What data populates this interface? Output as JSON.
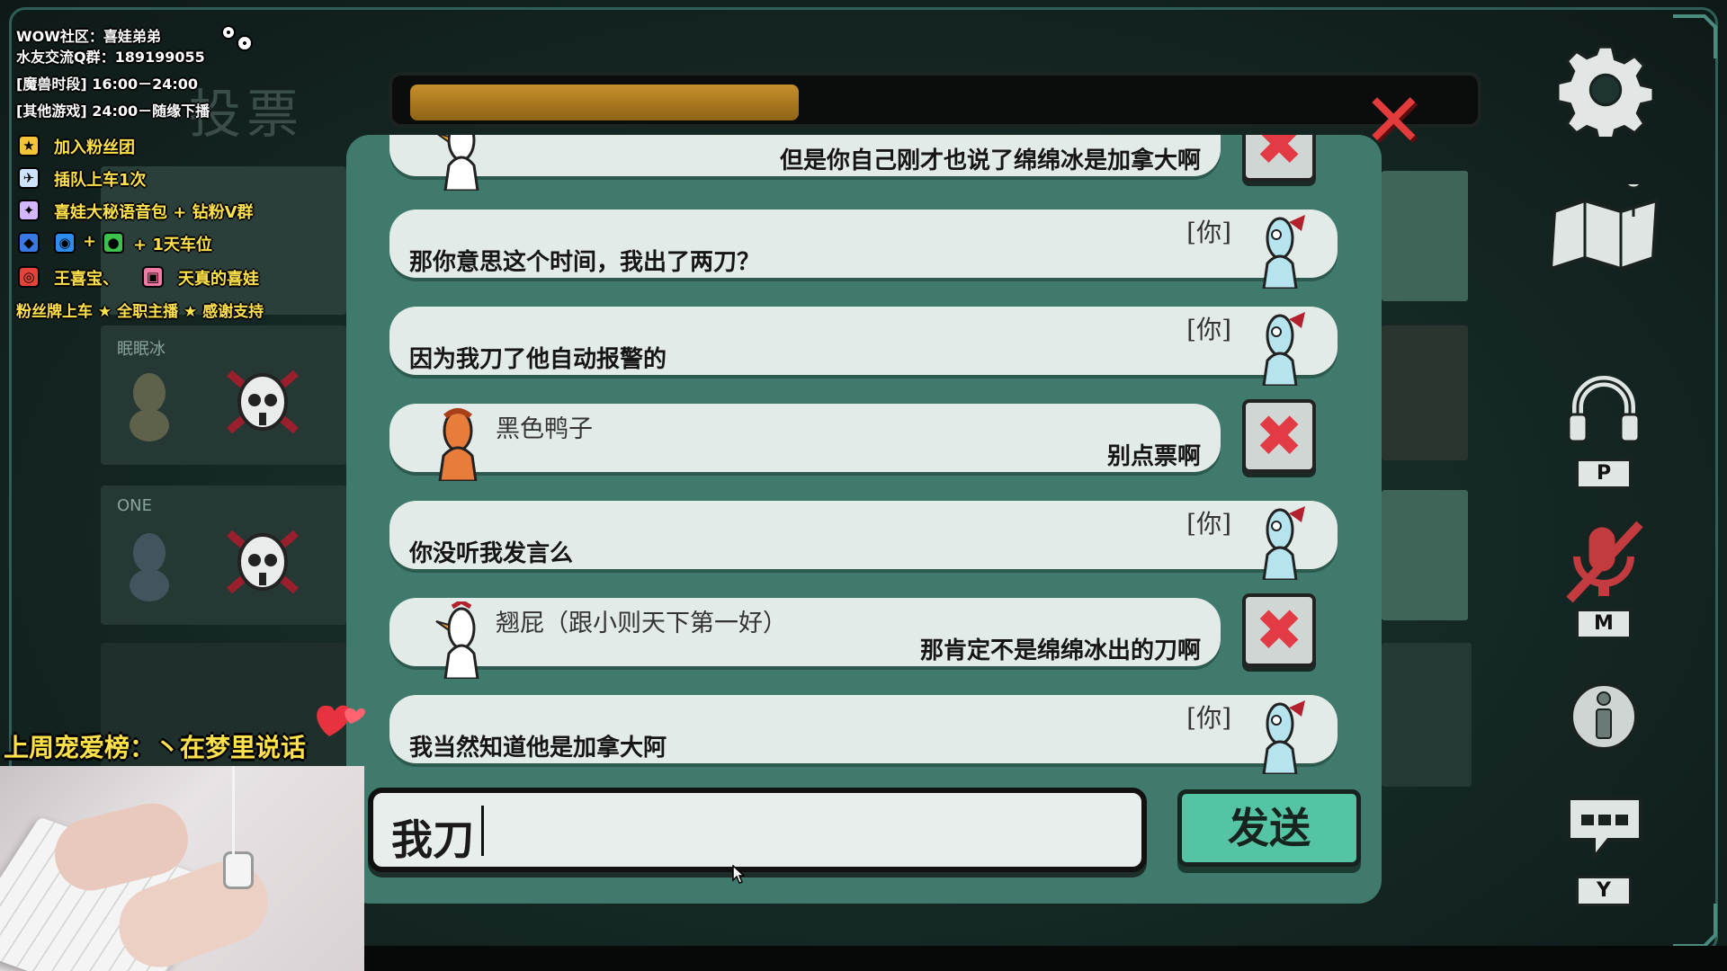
{
  "overlay": {
    "line1": "WOW社区：喜娃弟弟",
    "line2": "水友交流Q群：189199055",
    "line3": "[魔兽时段] 16:00－24:00",
    "line4": "[其他游戏] 24:00－随缘下播",
    "items": [
      {
        "icon": "star-badge-icon",
        "text": "加入粉丝团"
      },
      {
        "icon": "plane-icon",
        "text": "插队上车1次"
      },
      {
        "icon": "medal-icon",
        "text": "喜娃大秘语音包 + 钻粉V群"
      },
      {
        "icon": "qq-icon",
        "text": "+"
      },
      {
        "icon": "wechat-icon",
        "text": "+ 1天车位"
      },
      {
        "icon": "weibo-icon",
        "text": "王喜宝、"
      },
      {
        "icon": "bilibili-icon",
        "text": "天真的喜娃"
      }
    ],
    "footer": "粉丝牌上车 ★ 全职主播 ★ 感谢支持",
    "weekly_rank": "上周宠爱榜：丶在梦里说话"
  },
  "vote_title": "投票",
  "players": [
    {
      "name": "眠眠冰"
    },
    {
      "name": "ONE"
    }
  ],
  "timer": {
    "progress": 0.37
  },
  "chat": {
    "messages": [
      {
        "type": "other",
        "sender": "",
        "text": "但是你自己刚才也说了绵绵冰是加拿大啊",
        "avatar": "goose-white-icon"
      },
      {
        "type": "self",
        "tag": "[你]",
        "text": "那你意思这个时间，我出了两刀？"
      },
      {
        "type": "self",
        "tag": "[你]",
        "text": "因为我刀了他自动报警的"
      },
      {
        "type": "other",
        "sender": "黑色鸭子",
        "text": "别点票啊",
        "avatar": "duck-orange-icon"
      },
      {
        "type": "self",
        "tag": "[你]",
        "text": "你没听我发言么"
      },
      {
        "type": "other",
        "sender": "翘屁（跟小则天下第一好）",
        "text": "那肯定不是绵绵冰出的刀啊",
        "avatar": "goose-white-icon"
      },
      {
        "type": "self",
        "tag": "[你]",
        "text": "我当然知道他是加拿大阿"
      }
    ],
    "input_value": "我刀",
    "send_label": "发送"
  },
  "right_buttons": {
    "push_to_talk_key": "P",
    "mute_key": "M",
    "chat_key": "Y"
  },
  "colors": {
    "panel": "#3f7a6c",
    "bubble": "#e3ebe8",
    "send": "#55c4a4",
    "timer": "#b07f22",
    "report": "#e23b45"
  }
}
